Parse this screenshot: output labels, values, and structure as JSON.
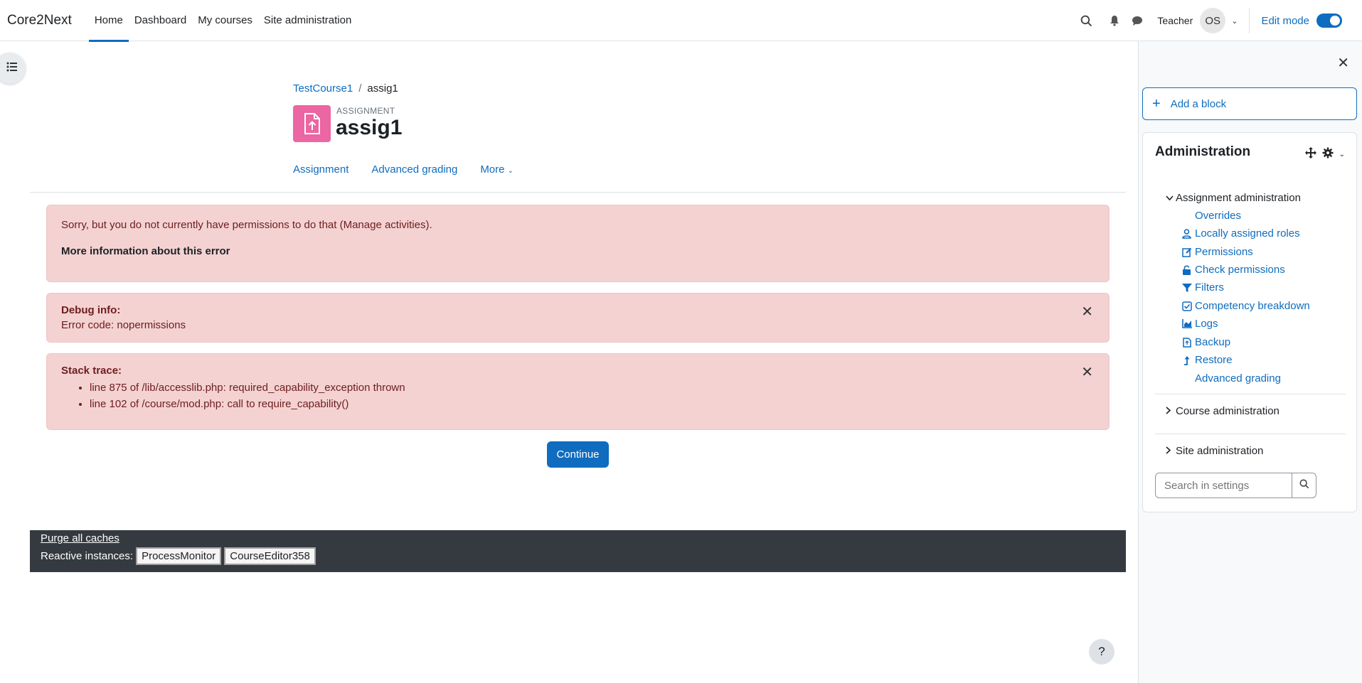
{
  "navbar": {
    "brand": "Core2Next",
    "links": [
      "Home",
      "Dashboard",
      "My courses",
      "Site administration"
    ],
    "role": "Teacher",
    "avatar_initials": "OS",
    "edit_mode_label": "Edit mode"
  },
  "breadcrumb": {
    "course": "TestCourse1",
    "current": "assig1"
  },
  "header": {
    "activity_type": "ASSIGNMENT",
    "title": "assig1"
  },
  "secondary_nav": [
    "Assignment",
    "Advanced grading",
    "More"
  ],
  "errors": {
    "permission_message": "Sorry, but you do not currently have permissions to do that (Manage activities).",
    "more_info": "More information about this error",
    "debug_heading": "Debug info:",
    "debug_text": "Error code: nopermissions",
    "stack_heading": "Stack trace:",
    "stack_lines": [
      "line 875 of /lib/accesslib.php: required_capability_exception thrown",
      "line 102 of /course/mod.php: call to require_capability()"
    ]
  },
  "continue_label": "Continue",
  "perf": {
    "purge_label": "Purge all caches",
    "reactive_label": "Reactive instances:",
    "instances": [
      "ProcessMonitor",
      "CourseEditor358"
    ]
  },
  "help_label": "?",
  "drawer": {
    "add_block": "Add a block",
    "admin_title": "Administration",
    "assignment_admin": "Assignment administration",
    "items": [
      {
        "label": "Overrides",
        "icon": "none"
      },
      {
        "label": "Locally assigned roles",
        "icon": "user-icon"
      },
      {
        "label": "Permissions",
        "icon": "edit-icon"
      },
      {
        "label": "Check permissions",
        "icon": "unlock-icon"
      },
      {
        "label": "Filters",
        "icon": "filter-icon"
      },
      {
        "label": "Competency breakdown",
        "icon": "checkbox-icon"
      },
      {
        "label": "Logs",
        "icon": "chart-icon"
      },
      {
        "label": "Backup",
        "icon": "file-icon"
      },
      {
        "label": "Restore",
        "icon": "upload-arrow-icon"
      },
      {
        "label": "Advanced grading",
        "icon": "none"
      }
    ],
    "course_admin": "Course administration",
    "site_admin": "Site administration",
    "search_placeholder": "Search in settings"
  },
  "colors": {
    "accent": "#0f6cbf",
    "alert_bg": "#f4d2d2",
    "assignment_icon": "#eb66a2",
    "perf_bg": "#343a40"
  }
}
